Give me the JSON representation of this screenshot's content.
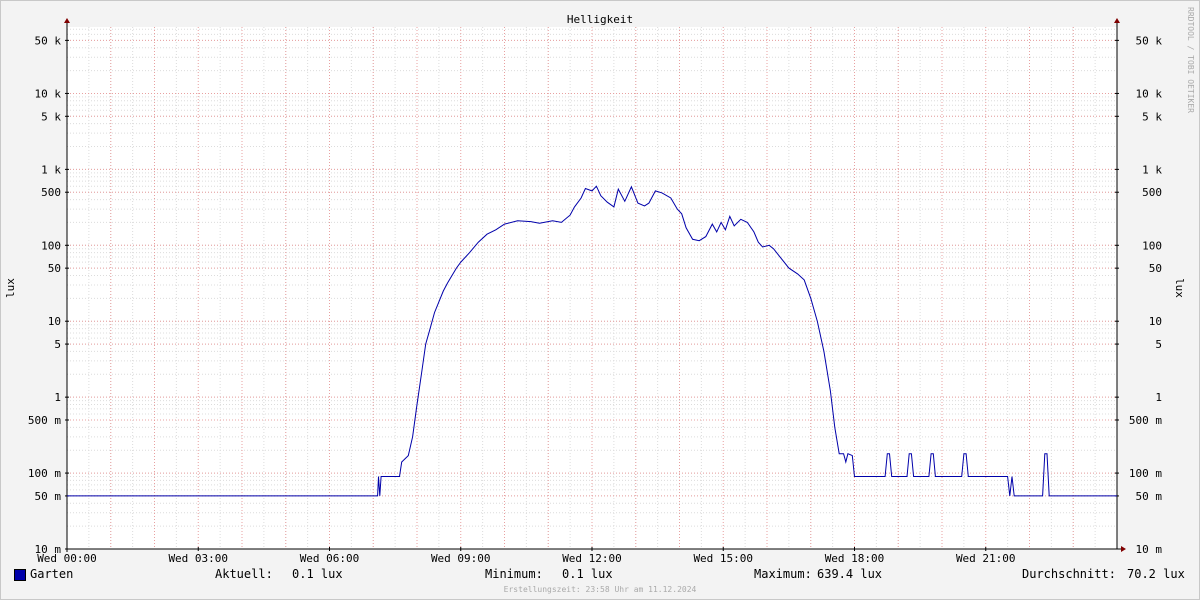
{
  "chart_data": {
    "type": "line",
    "title": "Helligkeit",
    "ylabel": "lux",
    "y_scale": "log",
    "ylim": [
      0.01,
      75000
    ],
    "xlim": [
      "Wed 00:00",
      "Thu 00:00"
    ],
    "grid": true,
    "y_ticks": [
      {
        "value": 0.01,
        "label": "10 m"
      },
      {
        "value": 0.05,
        "label": "50 m"
      },
      {
        "value": 0.1,
        "label": "100 m"
      },
      {
        "value": 0.5,
        "label": "500 m"
      },
      {
        "value": 1,
        "label": "1"
      },
      {
        "value": 5,
        "label": "5"
      },
      {
        "value": 10,
        "label": "10"
      },
      {
        "value": 50,
        "label": "50"
      },
      {
        "value": 100,
        "label": "100"
      },
      {
        "value": 500,
        "label": "500"
      },
      {
        "value": 1000,
        "label": "1 k"
      },
      {
        "value": 5000,
        "label": "5 k"
      },
      {
        "value": 10000,
        "label": "10 k"
      },
      {
        "value": 50000,
        "label": "50 k"
      }
    ],
    "x_ticks": [
      {
        "hour": 0,
        "label": "Wed 00:00"
      },
      {
        "hour": 3,
        "label": "Wed 03:00"
      },
      {
        "hour": 6,
        "label": "Wed 06:00"
      },
      {
        "hour": 9,
        "label": "Wed 09:00"
      },
      {
        "hour": 12,
        "label": "Wed 12:00"
      },
      {
        "hour": 15,
        "label": "Wed 15:00"
      },
      {
        "hour": 18,
        "label": "Wed 18:00"
      },
      {
        "hour": 21,
        "label": "Wed 21:00"
      }
    ],
    "series": [
      {
        "name": "Garten",
        "color": "#0000aa",
        "points": [
          [
            0,
            0.05
          ],
          [
            7.1,
            0.05
          ],
          [
            7.12,
            0.09
          ],
          [
            7.15,
            0.05
          ],
          [
            7.18,
            0.09
          ],
          [
            7.6,
            0.09
          ],
          [
            7.65,
            0.14
          ],
          [
            7.8,
            0.17
          ],
          [
            7.9,
            0.3
          ],
          [
            8.0,
            0.8
          ],
          [
            8.1,
            2
          ],
          [
            8.2,
            5
          ],
          [
            8.3,
            8
          ],
          [
            8.4,
            13
          ],
          [
            8.5,
            18
          ],
          [
            8.6,
            25
          ],
          [
            8.7,
            32
          ],
          [
            8.8,
            40
          ],
          [
            8.9,
            50
          ],
          [
            9.0,
            60
          ],
          [
            9.2,
            80
          ],
          [
            9.4,
            110
          ],
          [
            9.6,
            140
          ],
          [
            9.8,
            160
          ],
          [
            10.0,
            190
          ],
          [
            10.3,
            210
          ],
          [
            10.6,
            205
          ],
          [
            10.8,
            195
          ],
          [
            11.1,
            210
          ],
          [
            11.3,
            200
          ],
          [
            11.5,
            250
          ],
          [
            11.6,
            320
          ],
          [
            11.75,
            420
          ],
          [
            11.85,
            560
          ],
          [
            12.0,
            520
          ],
          [
            12.1,
            600
          ],
          [
            12.2,
            450
          ],
          [
            12.35,
            370
          ],
          [
            12.5,
            320
          ],
          [
            12.6,
            550
          ],
          [
            12.75,
            380
          ],
          [
            12.9,
            590
          ],
          [
            13.05,
            360
          ],
          [
            13.2,
            330
          ],
          [
            13.3,
            360
          ],
          [
            13.45,
            520
          ],
          [
            13.6,
            490
          ],
          [
            13.8,
            420
          ],
          [
            13.95,
            300
          ],
          [
            14.05,
            260
          ],
          [
            14.15,
            170
          ],
          [
            14.3,
            120
          ],
          [
            14.45,
            115
          ],
          [
            14.6,
            130
          ],
          [
            14.75,
            190
          ],
          [
            14.85,
            150
          ],
          [
            14.95,
            200
          ],
          [
            15.05,
            160
          ],
          [
            15.15,
            240
          ],
          [
            15.25,
            180
          ],
          [
            15.4,
            220
          ],
          [
            15.55,
            200
          ],
          [
            15.7,
            150
          ],
          [
            15.8,
            110
          ],
          [
            15.9,
            95
          ],
          [
            16.05,
            100
          ],
          [
            16.15,
            90
          ],
          [
            16.3,
            70
          ],
          [
            16.5,
            50
          ],
          [
            16.7,
            42
          ],
          [
            16.85,
            35
          ],
          [
            17.0,
            20
          ],
          [
            17.15,
            10
          ],
          [
            17.3,
            4
          ],
          [
            17.45,
            1.2
          ],
          [
            17.55,
            0.4
          ],
          [
            17.65,
            0.18
          ],
          [
            17.75,
            0.18
          ],
          [
            17.8,
            0.14
          ],
          [
            17.85,
            0.18
          ],
          [
            17.95,
            0.17
          ],
          [
            18.0,
            0.09
          ],
          [
            18.7,
            0.09
          ],
          [
            18.75,
            0.18
          ],
          [
            18.8,
            0.18
          ],
          [
            18.85,
            0.09
          ],
          [
            19.2,
            0.09
          ],
          [
            19.25,
            0.18
          ],
          [
            19.3,
            0.18
          ],
          [
            19.35,
            0.09
          ],
          [
            19.7,
            0.09
          ],
          [
            19.75,
            0.18
          ],
          [
            19.8,
            0.18
          ],
          [
            19.85,
            0.09
          ],
          [
            20.45,
            0.09
          ],
          [
            20.5,
            0.18
          ],
          [
            20.55,
            0.18
          ],
          [
            20.6,
            0.09
          ],
          [
            21.5,
            0.09
          ],
          [
            21.55,
            0.05
          ],
          [
            21.6,
            0.09
          ],
          [
            21.65,
            0.05
          ],
          [
            22.3,
            0.05
          ],
          [
            22.35,
            0.18
          ],
          [
            22.4,
            0.18
          ],
          [
            22.45,
            0.05
          ],
          [
            24,
            0.05
          ]
        ]
      }
    ]
  },
  "legend": {
    "swatch_color": "#0000aa",
    "series_name": "Garten",
    "current_label": "Aktuell:",
    "current_value": "0.1 lux",
    "min_label": "Minimum:",
    "min_value": "0.1 lux",
    "max_label": "Maximum:",
    "max_value": "639.4 lux",
    "avg_label": "Durchschnitt:",
    "avg_value": "70.2 lux"
  },
  "footer": "Erstellungszeit: 23:58 Uhr am 11.12.2024",
  "watermark": "RRDTOOL / TOBI OETIKER"
}
